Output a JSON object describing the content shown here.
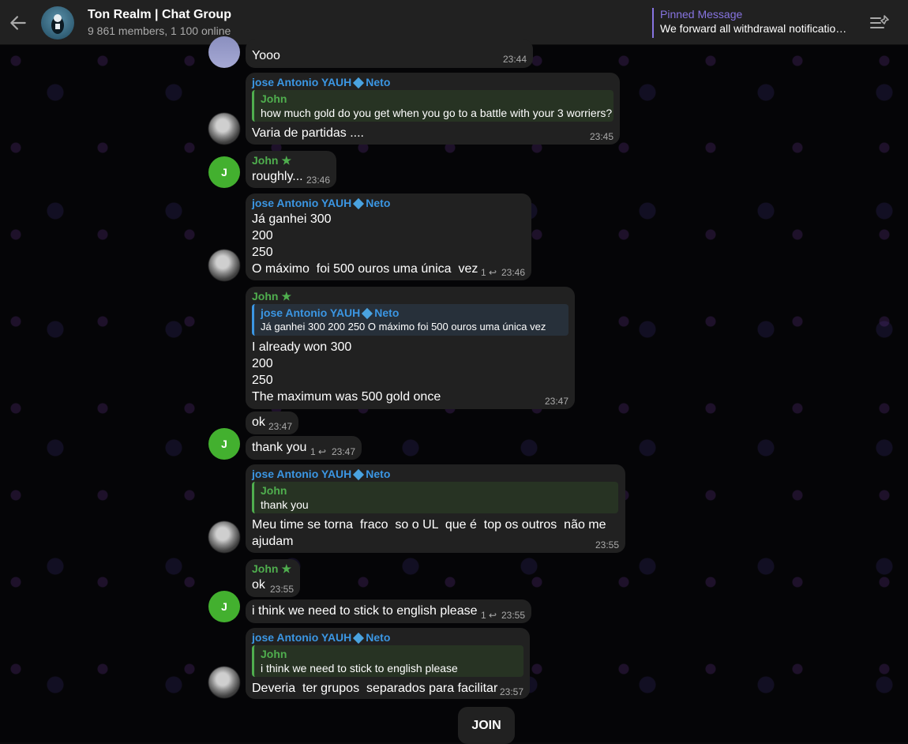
{
  "header": {
    "title": "Ton Realm | Chat Group",
    "subtitle": "9 861 members, 1 100 online",
    "pinned_title": "Pinned Message",
    "pinned_text": "We forward all withdrawal notificatio…"
  },
  "messages": [
    {
      "text": "Yooo",
      "time": "23:44"
    },
    {
      "author": "jose Antonio YAUH",
      "author_suffix": "Neto",
      "reply_name": "John",
      "reply_text": "how much gold do you get when you go to a battle with your 3 worriers?",
      "text": "Varia de partidas ....",
      "time": "23:45"
    },
    {
      "author": "John",
      "text": "roughly...",
      "time": "23:46"
    },
    {
      "author": "jose Antonio YAUH",
      "author_suffix": "Neto",
      "text": "Já ganhei 300\n200\n250\nO máximo  foi 500 ouros uma única  vez",
      "replies": "1",
      "time": "23:46"
    },
    {
      "author": "John",
      "reply_name": "jose Antonio YAUH",
      "reply_name_suffix": "Neto",
      "reply_text": "Já ganhei 300 200 250 O máximo foi 500 ouros uma única vez",
      "text": "I already won 300\n200\n250\nThe maximum was 500 gold once",
      "time": "23:47"
    },
    {
      "text": "ok",
      "time": "23:47"
    },
    {
      "text": "thank you",
      "replies": "1",
      "time": "23:47"
    },
    {
      "author": "jose Antonio YAUH",
      "author_suffix": "Neto",
      "reply_name": "John",
      "reply_text": "thank you",
      "text": "Meu time se torna  fraco  so o UL  que é  top os outros  não me\najudam",
      "time": "23:55"
    },
    {
      "author": "John",
      "text": "ok",
      "time": "23:55"
    },
    {
      "text": "i think we need to stick to english please",
      "replies": "1",
      "time": "23:55"
    },
    {
      "author": "jose Antonio YAUH",
      "author_suffix": "Neto",
      "reply_name": "John",
      "reply_text": "i think we need to stick to english please",
      "text": "Deveria  ter grupos  separados para facilitar",
      "time": "23:57"
    }
  ],
  "avatars": {
    "john_initial": "J"
  },
  "join_label": "JOIN"
}
